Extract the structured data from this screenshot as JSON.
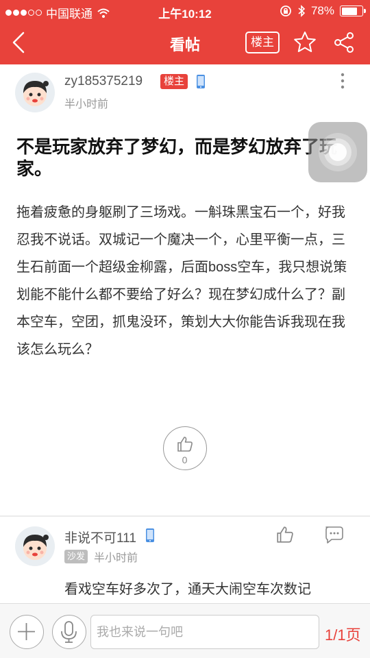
{
  "status_bar": {
    "carrier": "中国联通",
    "time": "上午10:12",
    "battery": "78%",
    "battery_level": 0.78
  },
  "nav": {
    "title": "看帖",
    "owner_only_label": "楼主",
    "icons": {
      "back": "chevron-left-icon",
      "star": "star-icon",
      "share": "share-icon"
    }
  },
  "post": {
    "author": "zy185375219",
    "owner_badge": "楼主",
    "time": "半小时前",
    "title": "不是玩家放弃了梦幻，而是梦幻放弃了玩家。",
    "body": "拖着疲惫的身躯刷了三场戏。一斛珠黑宝石一个，好我忍我不说话。双城记一个魔决一个，心里平衡一点，三生石前面一个超级金柳露，后面boss空车，我只想说策划能不能什么都不要给了好么？现在梦幻成什么了？副本空车，空团，抓鬼没环，策划大大你能告诉我现在我该怎么玩么？",
    "like_count": "0"
  },
  "reply": {
    "author": "非说不可111",
    "floor": "沙发",
    "time": "半小时前",
    "text": "看戏空车好多次了，通天大闹空车次数记"
  },
  "bottom": {
    "placeholder": "我也来说一句吧",
    "page": "1/1页"
  },
  "colors": {
    "brand": "#e8423b",
    "text": "#333333",
    "muted": "#999999"
  }
}
